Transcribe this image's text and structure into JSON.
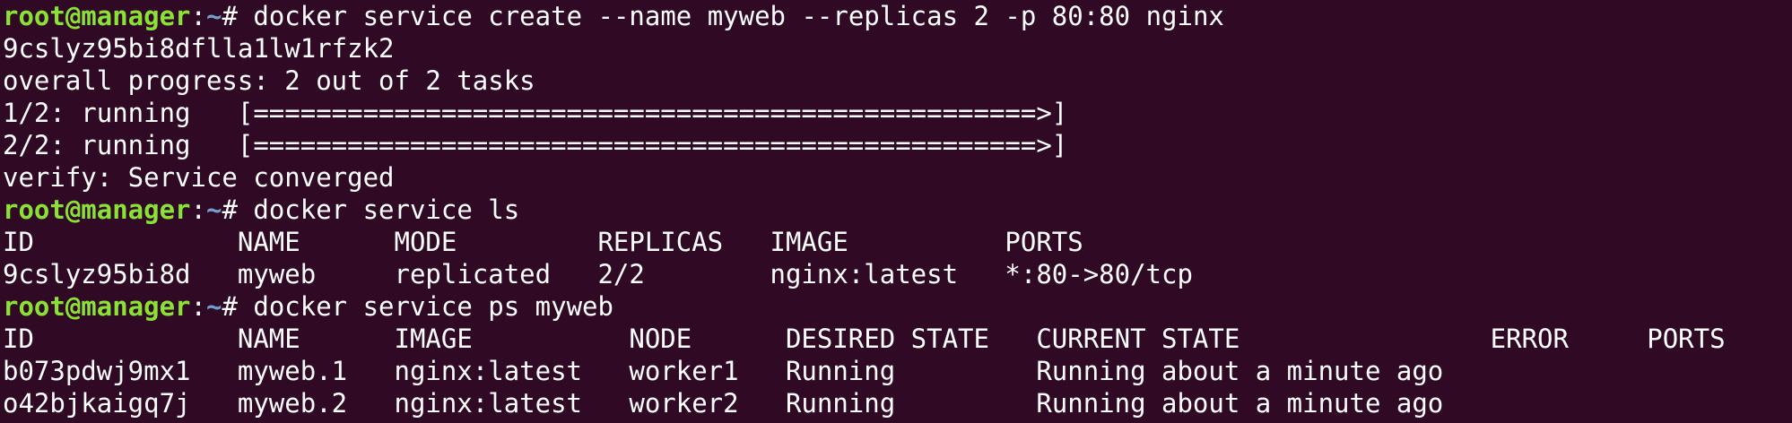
{
  "colors": {
    "background": "#300a24",
    "foreground": "#ffffff",
    "prompt_user": "#8ae234",
    "prompt_path": "#729fcf"
  },
  "lines": [
    {
      "type": "prompt",
      "user": "root@manager",
      "sep": ":",
      "path": "~",
      "sym": "# ",
      "cmd": "docker service create --name myweb --replicas 2 -p 80:80 nginx"
    },
    {
      "type": "out",
      "text": "9cslyz95bi8dflla1lw1rfzk2"
    },
    {
      "type": "out",
      "text": "overall progress: 2 out of 2 tasks"
    },
    {
      "type": "out",
      "text": "1/2: running   [==================================================>]"
    },
    {
      "type": "out",
      "text": "2/2: running   [==================================================>]"
    },
    {
      "type": "out",
      "text": "verify: Service converged"
    },
    {
      "type": "prompt",
      "user": "root@manager",
      "sep": ":",
      "path": "~",
      "sym": "# ",
      "cmd": "docker service ls"
    },
    {
      "type": "out",
      "text": "ID             NAME      MODE         REPLICAS   IMAGE          PORTS"
    },
    {
      "type": "out",
      "text": "9cslyz95bi8d   myweb     replicated   2/2        nginx:latest   *:80->80/tcp"
    },
    {
      "type": "prompt",
      "user": "root@manager",
      "sep": ":",
      "path": "~",
      "sym": "# ",
      "cmd": "docker service ps myweb"
    },
    {
      "type": "out",
      "text": "ID             NAME      IMAGE          NODE      DESIRED STATE   CURRENT STATE                ERROR     PORTS"
    },
    {
      "type": "out",
      "text": "b073pdwj9mx1   myweb.1   nginx:latest   worker1   Running         Running about a minute ago"
    },
    {
      "type": "out",
      "text": "o42bjkaigq7j   myweb.2   nginx:latest   worker2   Running         Running about a minute ago"
    }
  ]
}
